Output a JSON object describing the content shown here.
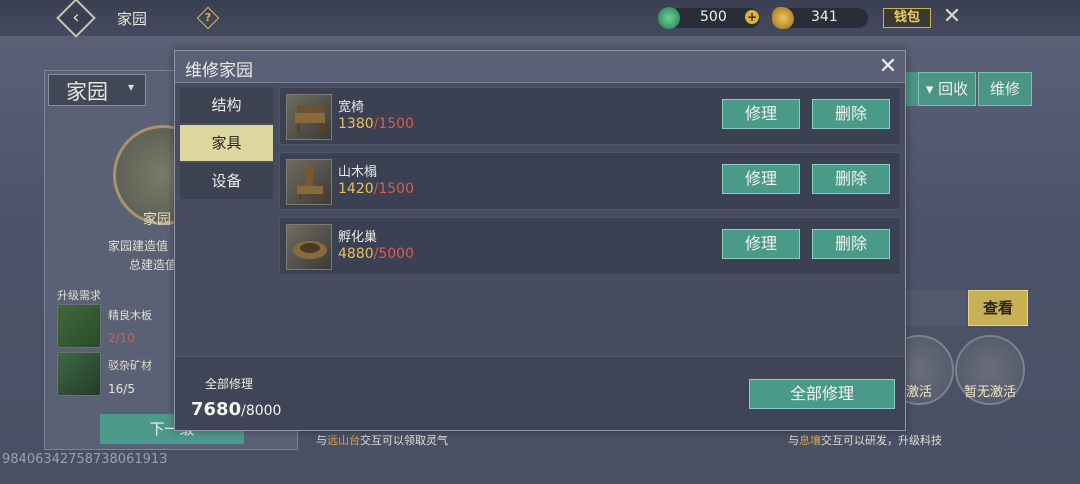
{
  "topbar": {
    "title": "家园",
    "jade_value": "500",
    "coin_value": "341",
    "wallet_label": "钱包"
  },
  "left_panel": {
    "home_select": "家园",
    "emblem_label": "家园",
    "build_value_label": "家园建造值",
    "total_value_label": "总建造值",
    "upgrade_req_title": "升级需求",
    "requirements": [
      {
        "name": "精良木板",
        "count": "2/10",
        "count_color": "#e0584c"
      },
      {
        "name": "驳杂矿材",
        "count": "16/5",
        "count_color": "#e6e3d8"
      }
    ],
    "next_button_label": "下一级"
  },
  "right_panel": {
    "recycle_label": "回收",
    "repair_label": "维修",
    "check_label": "查看",
    "inactive_1": "激活",
    "inactive_2": "暂无激活",
    "hint_right_pre": "与",
    "hint_right_hl": "息壤",
    "hint_right_post": "交互可以研发，升级科技",
    "hint_mid_pre": "与",
    "hint_mid_hl": "远山台",
    "hint_mid_post": "交互可以领取灵气"
  },
  "footer_id": "9840634275873806191З",
  "modal": {
    "title": "维修家园",
    "tabs": [
      {
        "label": "结构",
        "active": false
      },
      {
        "label": "家具",
        "active": true
      },
      {
        "label": "设备",
        "active": false
      }
    ],
    "items": [
      {
        "name": "宽椅",
        "current": "1380",
        "max": "/1500",
        "repair_label": "修理",
        "delete_label": "删除",
        "icon": "chair-icon"
      },
      {
        "name": "山木榻",
        "current": "1420",
        "max": "/1500",
        "repair_label": "修理",
        "delete_label": "删除",
        "icon": "couch-icon"
      },
      {
        "name": "孵化巢",
        "current": "4880",
        "max": "/5000",
        "repair_label": "修理",
        "delete_label": "删除",
        "icon": "nest-icon"
      }
    ],
    "footer": {
      "all_repair_label": "全部修理",
      "current": "7680",
      "max": "/8000",
      "all_repair_button": "全部修理"
    }
  }
}
